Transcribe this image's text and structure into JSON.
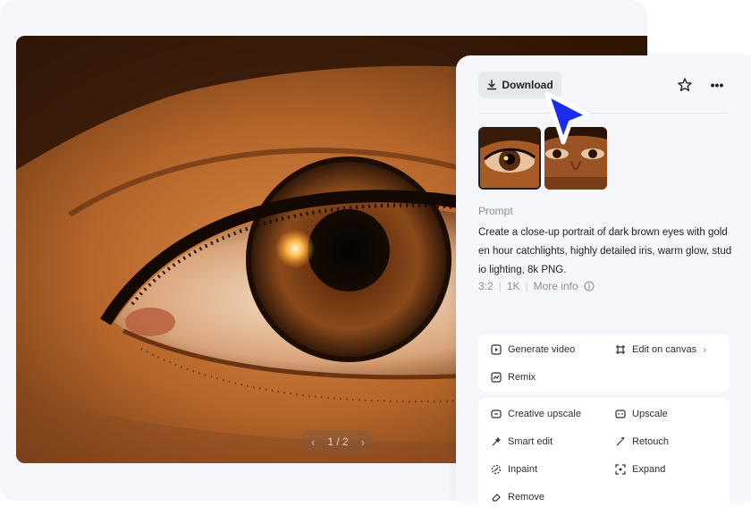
{
  "viewer": {
    "pager_text": "1 / 2"
  },
  "toolbar": {
    "download_label": "Download"
  },
  "prompt": {
    "label": "Prompt",
    "text": "Create a close-up portrait of dark brown eyes with golden hour catchlights, highly detailed iris, warm glow, studio lighting, 8k PNG."
  },
  "meta": {
    "ratio": "3:2",
    "resolution": "1K",
    "more_info": "More info"
  },
  "actions": {
    "generate_video": "Generate video",
    "edit_on_canvas": "Edit on canvas",
    "remix": "Remix",
    "creative_upscale": "Creative upscale",
    "upscale": "Upscale",
    "smart_edit": "Smart edit",
    "retouch": "Retouch",
    "inpaint": "Inpaint",
    "expand": "Expand",
    "remove": "Remove"
  },
  "colors": {
    "accent_cursor": "#1a2cf0",
    "panel_bg": "#f4f6f9"
  }
}
